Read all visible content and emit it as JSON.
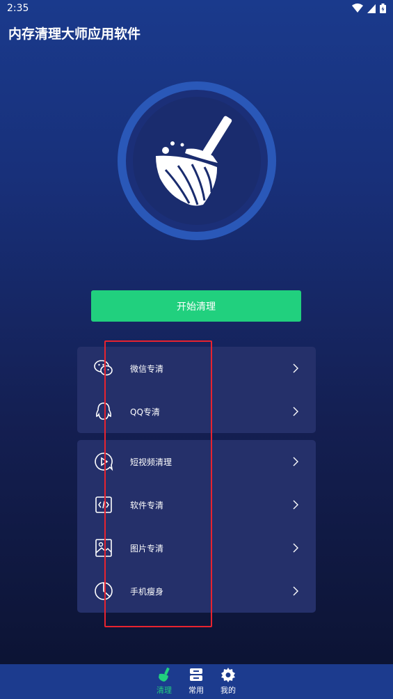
{
  "status_bar": {
    "time": "2:35"
  },
  "app": {
    "title": "内存清理大师应用软件"
  },
  "start_button": {
    "label": "开始清理"
  },
  "card_1": {
    "items": [
      {
        "label": "微信专清",
        "icon": "wechat-icon"
      },
      {
        "label": "QQ专清",
        "icon": "qq-icon"
      }
    ]
  },
  "card_2": {
    "items": [
      {
        "label": "短视频清理",
        "icon": "video-icon"
      },
      {
        "label": "软件专清",
        "icon": "code-icon"
      },
      {
        "label": "图片专清",
        "icon": "image-icon"
      },
      {
        "label": "手机瘦身",
        "icon": "pie-chart-icon"
      }
    ]
  },
  "tabbar": {
    "tabs": [
      {
        "label": "清理",
        "icon": "broom-icon",
        "active": true
      },
      {
        "label": "常用",
        "icon": "storage-icon",
        "active": false
      },
      {
        "label": "我的",
        "icon": "gear-icon",
        "active": false
      }
    ]
  },
  "colors": {
    "accent_green": "#21d07e",
    "card_bg": "#25306a",
    "tabbar_bg": "#1c3b8e",
    "highlight_red": "#e8232f"
  }
}
